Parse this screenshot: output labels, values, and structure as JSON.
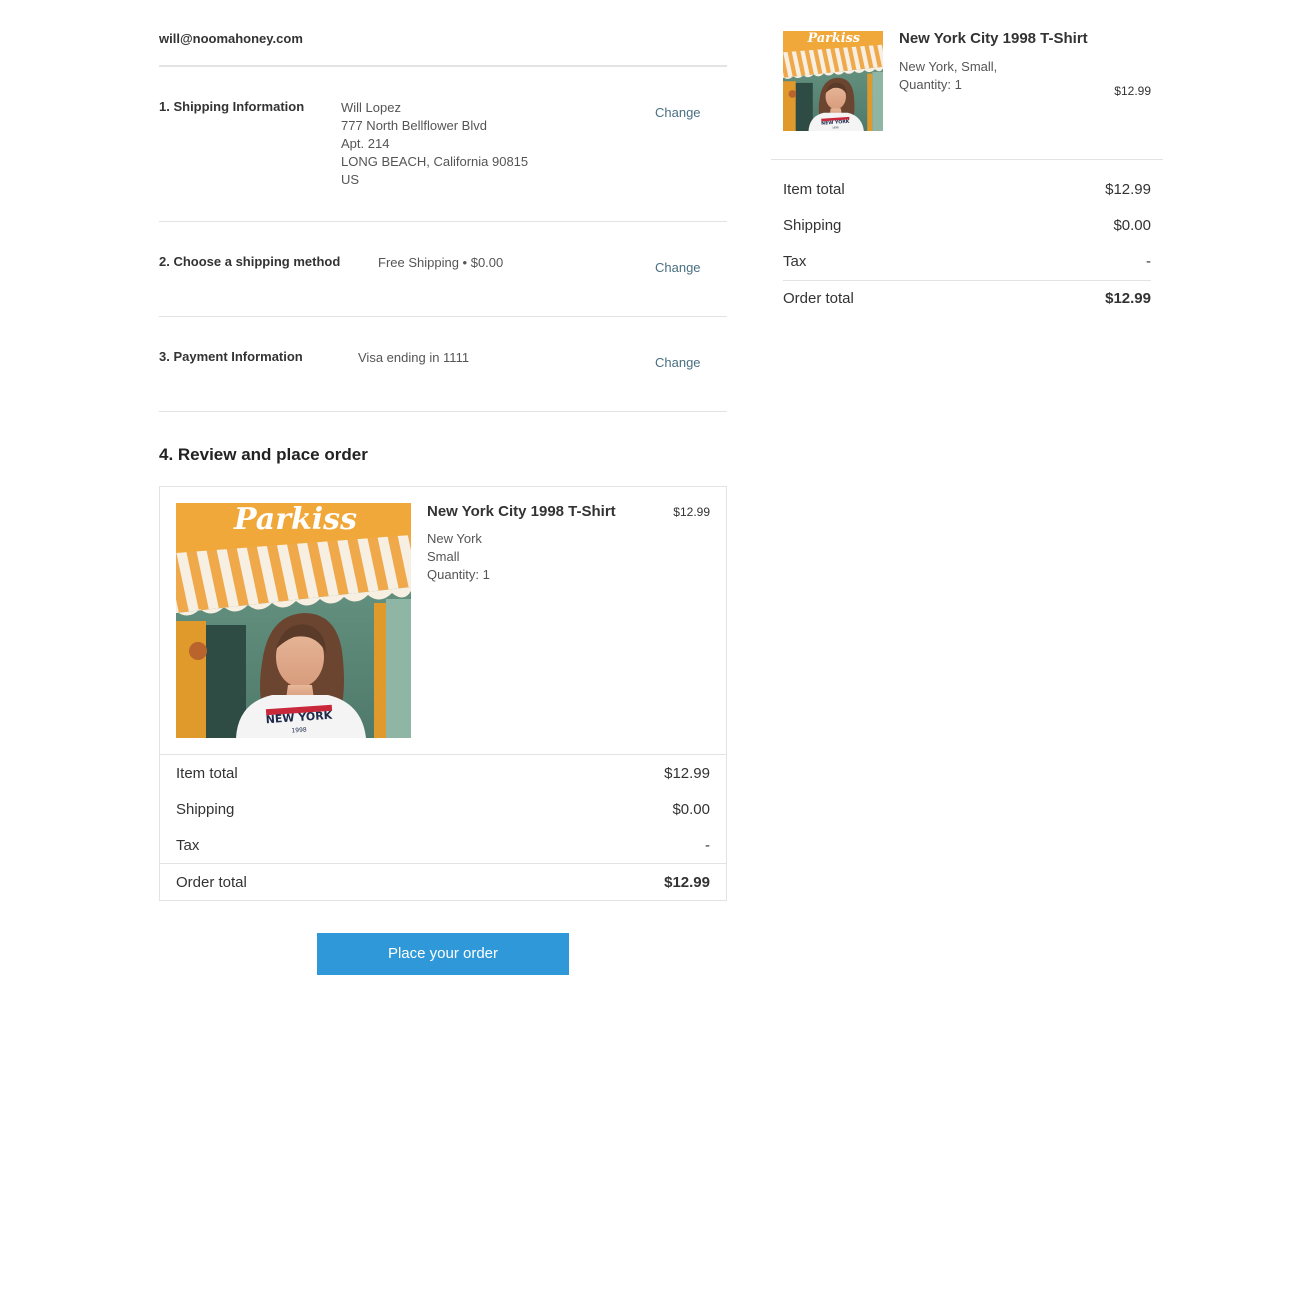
{
  "account": {
    "email": "will@noomahoney.com"
  },
  "steps": {
    "shipping_info": {
      "title": "1. Shipping Information",
      "address_lines": [
        "Will Lopez",
        "777 North Bellflower Blvd",
        "Apt. 214",
        "LONG BEACH, California 90815",
        "US"
      ],
      "change_label": "Change"
    },
    "shipping_method": {
      "title": "2. Choose a shipping method",
      "value": "Free Shipping • $0.00",
      "change_label": "Change"
    },
    "payment_info": {
      "title": "3. Payment Information",
      "value": "Visa ending in 1111",
      "change_label": "Change"
    }
  },
  "review": {
    "heading": "4. Review and place order",
    "product": {
      "name": "New York City 1998 T-Shirt",
      "price": "$12.99",
      "attributes": [
        "New York",
        "Small",
        "Quantity: 1"
      ]
    },
    "totals": {
      "item_total_label": "Item total",
      "item_total_value": "$12.99",
      "shipping_label": "Shipping",
      "shipping_value": "$0.00",
      "tax_label": "Tax",
      "tax_value": "-",
      "order_total_label": "Order total",
      "order_total_value": "$12.99"
    },
    "place_order_label": "Place your order"
  },
  "summary": {
    "product": {
      "name": "New York City 1998 T-Shirt",
      "attributes_line1": "New York, Small,",
      "attributes_line2": "Quantity: 1",
      "price": "$12.99"
    },
    "totals": {
      "item_total_label": "Item total",
      "item_total_value": "$12.99",
      "shipping_label": "Shipping",
      "shipping_value": "$0.00",
      "tax_label": "Tax",
      "tax_value": "-",
      "order_total_label": "Order total",
      "order_total_value": "$12.99"
    }
  },
  "image": {
    "shop_sign_text": "Parkiss",
    "shirt_print_text": "NEW YORK",
    "shirt_year_text": "1998"
  },
  "colors": {
    "accent_button": "#2e98d8",
    "link": "#4a6f82",
    "divider": "#e3e3e3"
  }
}
